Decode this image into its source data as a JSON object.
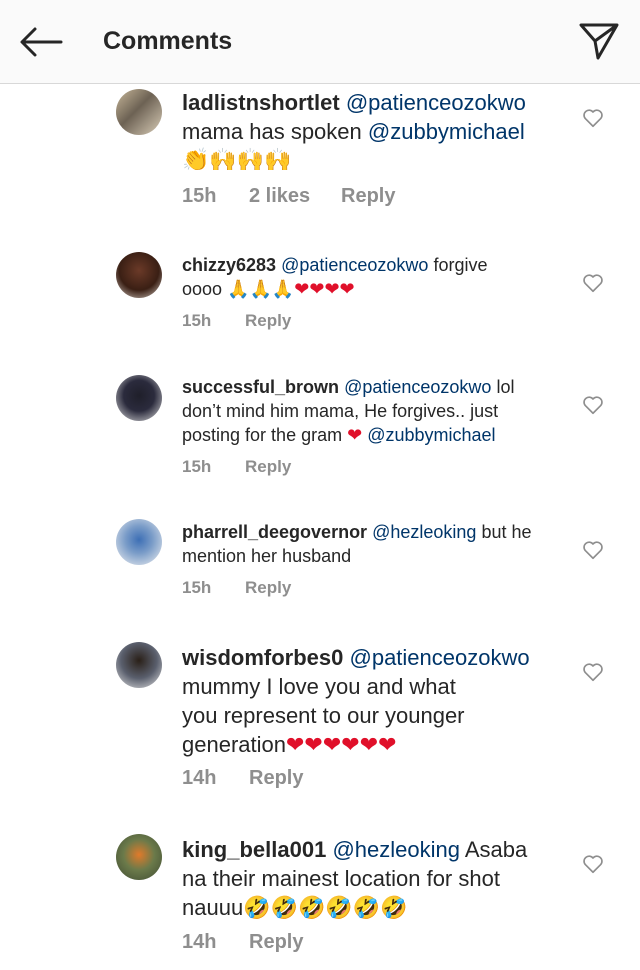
{
  "header": {
    "back_icon": "arrow-left-icon",
    "title": "Comments",
    "share_icon": "paper-plane-icon"
  },
  "comments": [
    {
      "username": "ladlistnshortlet",
      "mention": "@patienceozokwo",
      "text1": "mama has spoken",
      "mention2": "@zubbymichael",
      "emojis": "👏🙌🙌🙌",
      "time": "15h",
      "likes": "2 likes",
      "reply": "Reply"
    },
    {
      "username": "chizzy6283",
      "mention": "@patienceozokwo",
      "text1": "forgive",
      "text2": "oooo",
      "emojis": "🙏🙏🙏❤❤❤❤",
      "time": "15h",
      "reply": "Reply"
    },
    {
      "username": "successful_brown",
      "mention": "@patienceozokwo",
      "text1": "lol",
      "text2": "don’t mind him mama, He forgives.. just",
      "text3": "posting for the gram",
      "emojis": "❤",
      "mention2": "@zubbymichael",
      "time": "15h",
      "reply": "Reply"
    },
    {
      "username": "pharrell_deegovernor",
      "mention": "@hezleoking",
      "text1": "but he",
      "text2": "mention her husband",
      "time": "15h",
      "reply": "Reply"
    },
    {
      "username": "wisdomforbes0",
      "mention": "@patienceozokwo",
      "text2": "mummy I love you and what",
      "text3": "you represent to our younger",
      "text4": "generation",
      "emojis": "❤❤❤❤❤❤",
      "time": "14h",
      "reply": "Reply"
    },
    {
      "username": "king_bella001",
      "mention": "@hezleoking",
      "text1": "Asaba",
      "text2": "na their mainest location for shot",
      "text3": "nauuu",
      "emojis": "🤣🤣🤣🤣🤣🤣",
      "time": "14h",
      "reply": "Reply"
    }
  ],
  "colors": {
    "text": "#262626",
    "mention": "#003569",
    "meta": "#8e8e8e",
    "header_bg": "#fafafa",
    "heart_red": "#e0102a"
  }
}
